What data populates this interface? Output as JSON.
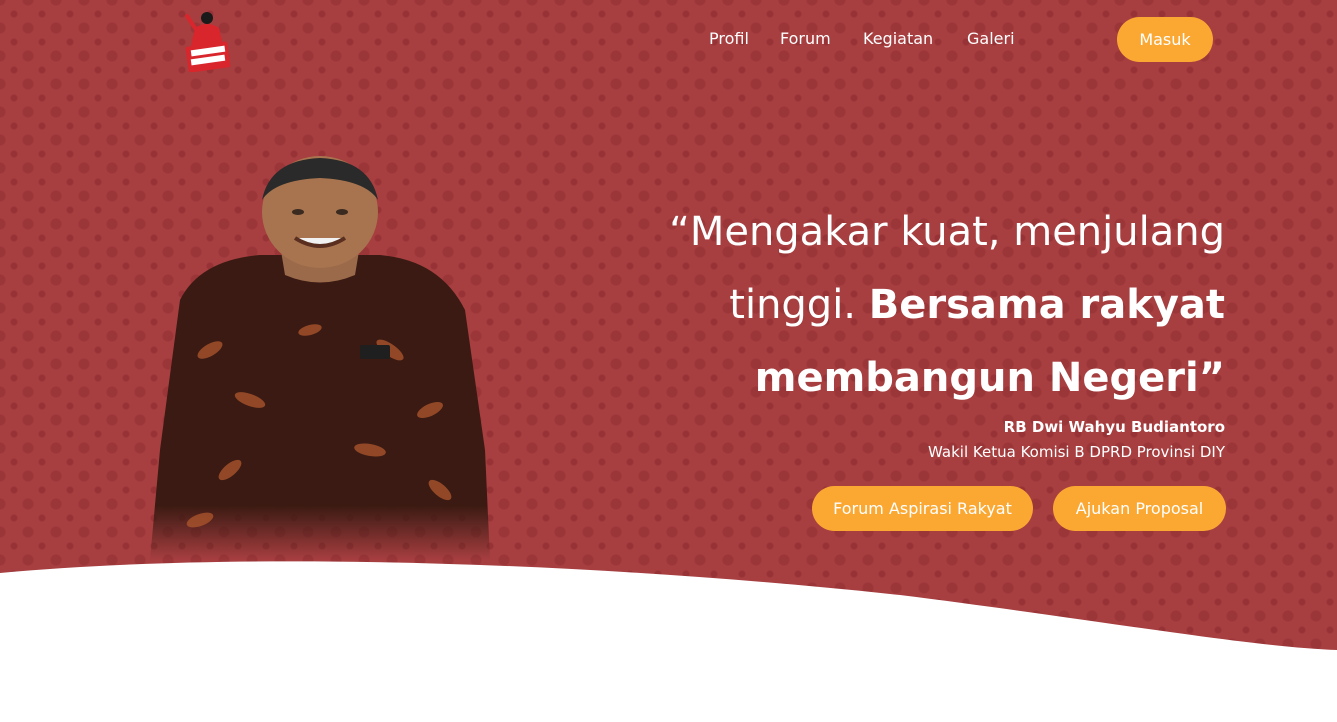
{
  "nav": {
    "items": [
      {
        "label": "Profil"
      },
      {
        "label": "Forum"
      },
      {
        "label": "Kegiatan"
      },
      {
        "label": "Galeri"
      }
    ],
    "login_label": "Masuk"
  },
  "hero": {
    "quote_regular": "“Mengakar kuat, menjulang tinggi.",
    "quote_bold": "Bersama rakyat membangun Negeri”",
    "person_name": "RB Dwi Wahyu Budiantoro",
    "person_role": "Wakil Ketua Komisi B DPRD Provinsi DIY",
    "cta_primary": "Forum Aspirasi Rakyat",
    "cta_secondary": "Ajukan Proposal"
  },
  "colors": {
    "brand_red": "#a73e40",
    "accent_orange": "#fba833",
    "white": "#ffffff"
  }
}
